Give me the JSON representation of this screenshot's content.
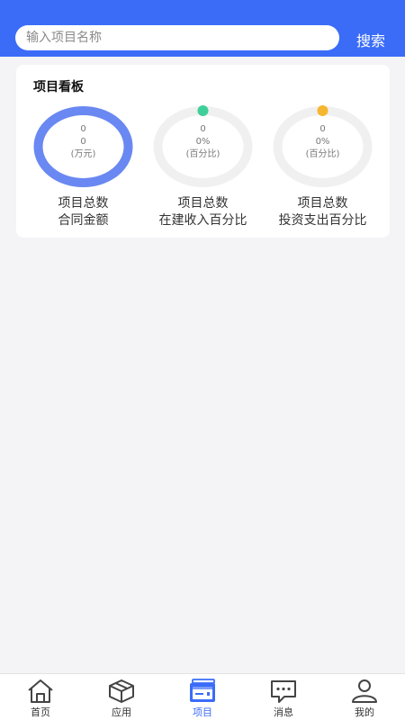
{
  "search": {
    "placeholder": "输入项目名称",
    "value": "",
    "button_label": "搜索"
  },
  "dashboard": {
    "title": "项目看板",
    "gauges": [
      {
        "line1": "0",
        "line2": "0",
        "unit": "(万元)",
        "label_line1": "项目总数",
        "label_line2": "合同金额",
        "ring_fraction": 1.0,
        "color": "#6a88f2"
      },
      {
        "line1": "0",
        "line2": "0%",
        "unit": "(百分比)",
        "label_line1": "项目总数",
        "label_line2": "在建收入百分比",
        "ring_fraction": 0.0,
        "color": "#3fcf9a"
      },
      {
        "line1": "0",
        "line2": "0%",
        "unit": "(百分比)",
        "label_line1": "项目总数",
        "label_line2": "投资支出百分比",
        "ring_fraction": 0.0,
        "color": "#f5b731"
      }
    ]
  },
  "tabbar": {
    "items": [
      {
        "label": "首页",
        "icon": "home-icon",
        "active": false
      },
      {
        "label": "应用",
        "icon": "box-icon",
        "active": false
      },
      {
        "label": "项目",
        "icon": "project-icon",
        "active": true
      },
      {
        "label": "消息",
        "icon": "message-icon",
        "active": false
      },
      {
        "label": "我的",
        "icon": "user-icon",
        "active": false
      }
    ]
  },
  "colors": {
    "accent": "#3b6cf8",
    "ring_track": "#f0f0f0"
  }
}
